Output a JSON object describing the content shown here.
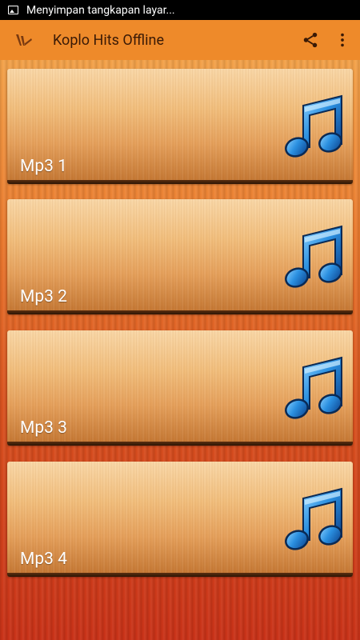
{
  "status_bar": {
    "notification_text": "Menyimpan tangkapan layar..."
  },
  "app_bar": {
    "title": "Koplo Hits Offline",
    "accent_color": "#ee8a2a",
    "actions": [
      "share-icon",
      "overflow-menu-icon"
    ]
  },
  "tracks": [
    {
      "label": "Mp3 1",
      "icon": "music-note-icon"
    },
    {
      "label": "Mp3 2",
      "icon": "music-note-icon"
    },
    {
      "label": "Mp3 3",
      "icon": "music-note-icon"
    },
    {
      "label": "Mp3 4",
      "icon": "music-note-icon"
    }
  ]
}
